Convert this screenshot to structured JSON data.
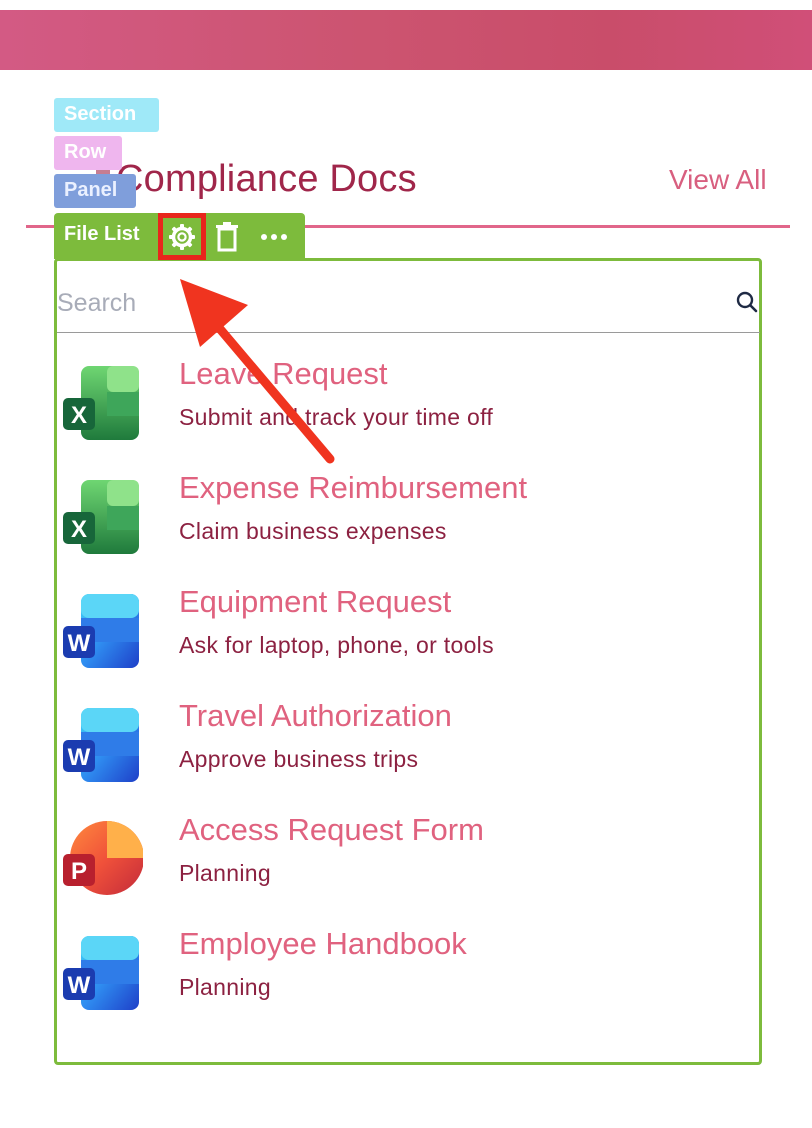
{
  "badges": {
    "section": "Section",
    "row": "Row",
    "panel": "Panel"
  },
  "panel": {
    "title": "Compliance Docs",
    "view_all": "View All"
  },
  "toolbar": {
    "label": "File List",
    "icons": [
      "gear-icon",
      "trash-icon",
      "more-icon"
    ]
  },
  "search": {
    "placeholder": "Search",
    "value": ""
  },
  "files": [
    {
      "title": "Leave Request",
      "subtitle": "Submit and track your time off",
      "app": "excel",
      "letter": "X"
    },
    {
      "title": "Expense Reimbursement",
      "subtitle": "Claim business expenses",
      "app": "excel",
      "letter": "X"
    },
    {
      "title": "Equipment Request",
      "subtitle": "Ask for laptop, phone, or tools",
      "app": "word",
      "letter": "W"
    },
    {
      "title": "Travel Authorization",
      "subtitle": "Approve business trips",
      "app": "word",
      "letter": "W"
    },
    {
      "title": "Access Request Form",
      "subtitle": "Planning",
      "app": "powerpoint",
      "letter": "P"
    },
    {
      "title": "Employee Handbook",
      "subtitle": "Planning",
      "app": "word",
      "letter": "W"
    }
  ],
  "colors": {
    "accent": "#e0627f",
    "title": "#a0264a",
    "toolbar": "#7dbb3c",
    "highlight": "#e8261c"
  }
}
